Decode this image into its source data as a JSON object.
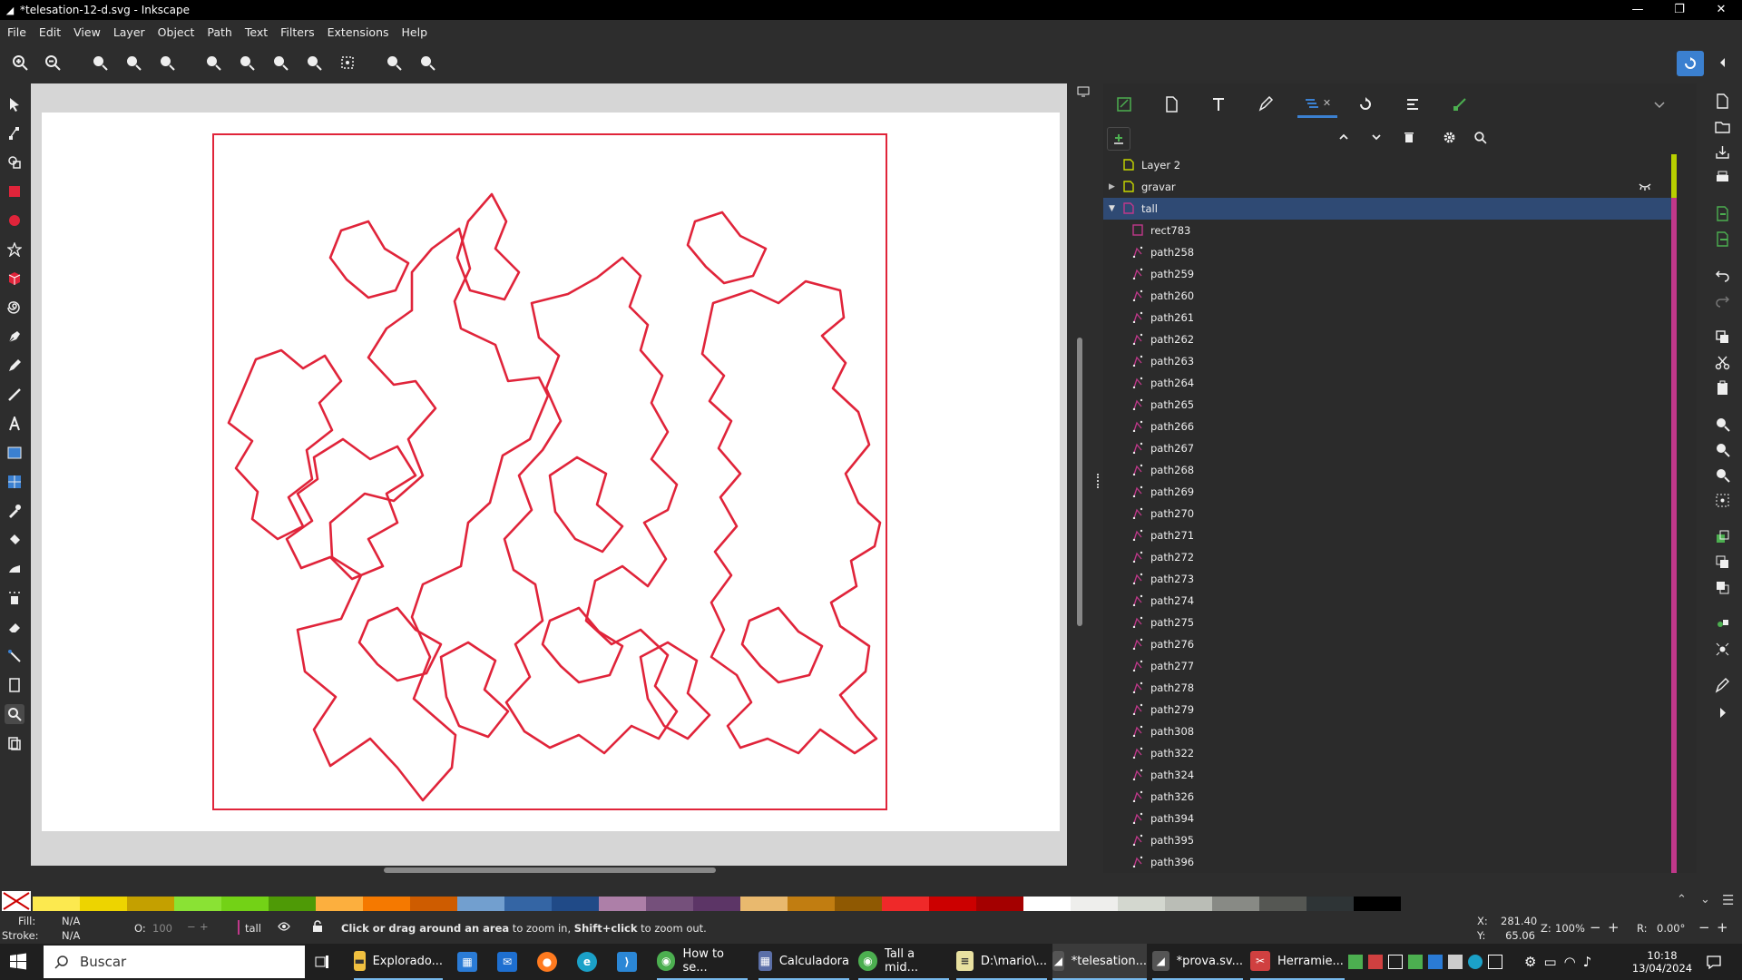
{
  "window": {
    "title": "*telesation-12-d.svg - Inkscape",
    "minimize": "—",
    "restore": "❐",
    "close": "✕"
  },
  "menu": [
    "File",
    "Edit",
    "View",
    "Layer",
    "Object",
    "Path",
    "Text",
    "Filters",
    "Extensions",
    "Help"
  ],
  "objects_panel": {
    "layers": [
      {
        "label": "Layer 2",
        "type": "layer",
        "color": "#b8d000"
      },
      {
        "label": "gravar",
        "type": "layer",
        "color": "#b8d000"
      },
      {
        "label": "tall",
        "type": "layer",
        "color": "#c0388a",
        "selected": true,
        "expanded": true
      }
    ],
    "children": [
      "rect783",
      "path258",
      "path259",
      "path260",
      "path261",
      "path262",
      "path263",
      "path264",
      "path265",
      "path266",
      "path267",
      "path268",
      "path269",
      "path270",
      "path271",
      "path272",
      "path273",
      "path274",
      "path275",
      "path276",
      "path277",
      "path278",
      "path279",
      "path308",
      "path322",
      "path324",
      "path326",
      "path394",
      "path395",
      "path396"
    ]
  },
  "palette_colors": [
    "#fce94f",
    "#edd400",
    "#c4a000",
    "#8ae234",
    "#73d216",
    "#4e9a06",
    "#fcaf3e",
    "#f57900",
    "#ce5c00",
    "#729fcf",
    "#3465a4",
    "#204a87",
    "#ad7fa8",
    "#75507b",
    "#5c3566",
    "#e9b96e",
    "#c17d11",
    "#8f5902",
    "#ef2929",
    "#cc0000",
    "#a40000",
    "#ffffff",
    "#eeeeec",
    "#d3d7cf",
    "#babdb6",
    "#888a85",
    "#555753",
    "#2e3436",
    "#000000"
  ],
  "status": {
    "fill_label": "Fill:",
    "fill_value": "N/A",
    "stroke_label": "Stroke:",
    "stroke_value": "N/A",
    "opacity_label": "O:",
    "opacity_value": "100",
    "layer_name": "tall",
    "message_bold1": "Click or drag around an area",
    "message_mid": " to zoom in, ",
    "message_bold2": "Shift+click",
    "message_end": " to zoom out.",
    "x_label": "X:",
    "x_value": "281.40",
    "y_label": "Y:",
    "y_value": "65.06",
    "zoom_label": "Z:",
    "zoom_value": "100%",
    "rot_label": "R:",
    "rot_value": "0.00°"
  },
  "taskbar": {
    "search_placeholder": "Buscar",
    "apps": [
      {
        "label": "Explorado...",
        "color": "#f0c040"
      },
      {
        "label": "How to se...",
        "color": "#4caf50"
      },
      {
        "label": "Calculadora",
        "color": "#5b6fa8"
      },
      {
        "label": "Tall a mid...",
        "color": "#4caf50"
      },
      {
        "label": "D:\\mario\\...",
        "color": "#e8e0a0"
      },
      {
        "label": "*telesation...",
        "color": "#555555"
      },
      {
        "label": "*prova.sv...",
        "color": "#555555"
      },
      {
        "label": "Herramie...",
        "color": "#d04040"
      }
    ],
    "time": "10:18",
    "date": "13/04/2024"
  }
}
